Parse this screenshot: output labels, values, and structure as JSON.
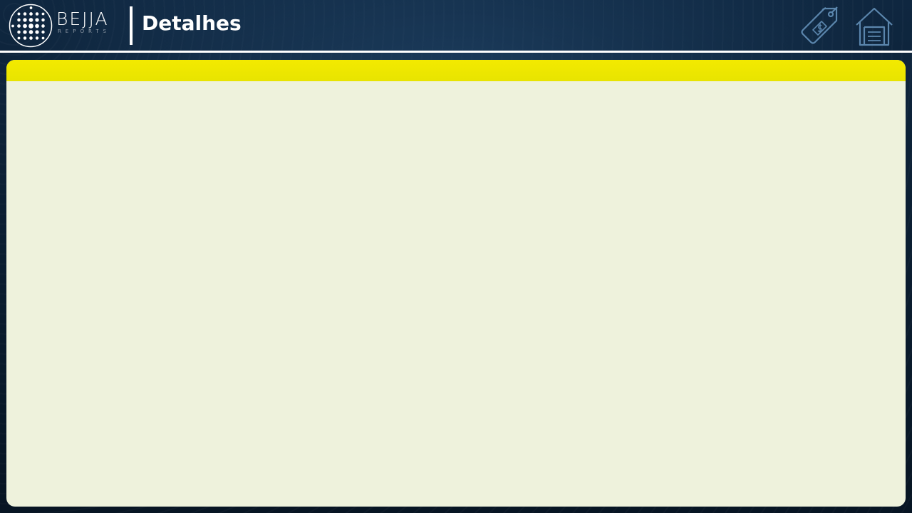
{
  "header": {
    "brand": {
      "name": "BEJJA",
      "sub": "REPORTS"
    },
    "title": "Detalhes",
    "icons": {
      "price": "price-tag-icon",
      "home": "home-icon"
    }
  },
  "panel": {
    "bar_color": "#ece800",
    "body_color": "#eef2dc"
  },
  "colors": {
    "background": "#0c2036",
    "icon_stroke": "#5b86ad",
    "text": "#ffffff"
  }
}
